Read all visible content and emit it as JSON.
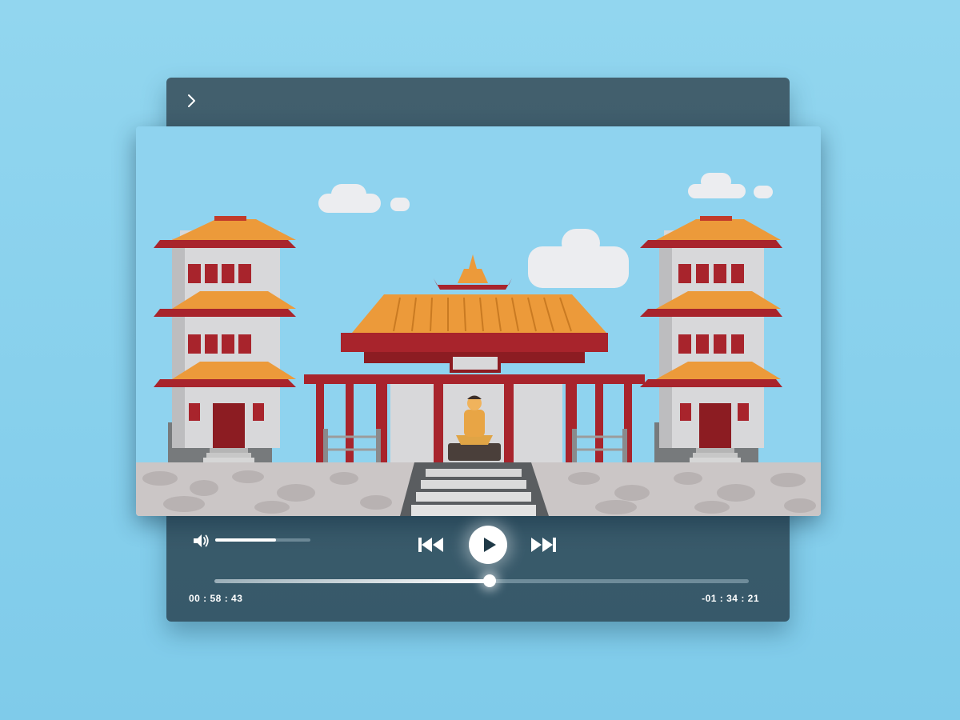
{
  "player": {
    "collapse_icon": "chevron-right-icon",
    "video": {
      "scene": "chinese-temple-illustration",
      "colors": {
        "sky": "#8fd3ef",
        "roof": "#ec9a3a",
        "wood": "#a8242c",
        "wall": "#d8d8da",
        "stone": "#cbc6c6",
        "controls_bg": "#3b5b6a"
      }
    },
    "controls": {
      "volume_icon": "speaker-icon",
      "volume_level": 0.64,
      "previous_icon": "skip-previous-icon",
      "play_icon": "play-icon",
      "next_icon": "skip-next-icon"
    },
    "progress": {
      "fraction": 0.515,
      "elapsed": "00 : 58 : 43",
      "remaining": "-01 : 34 : 21"
    }
  }
}
